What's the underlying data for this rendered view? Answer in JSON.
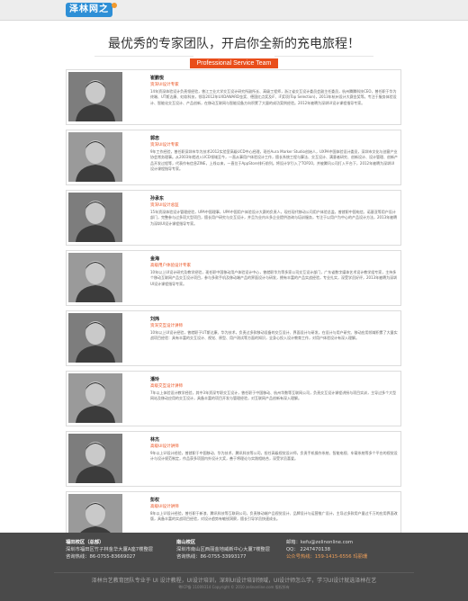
{
  "header": {
    "logo_text": "泽林网之"
  },
  "hero": {
    "title": "最优秀的专家团队，开启你全新的充电旅程！",
    "tagline": "Professional Service Team"
  },
  "experts": [
    {
      "name": "崔鹏悦",
      "role": "资深UI设计专家",
      "bio": "14年资深体验设计负责领经验，曾江工业大学交互设计研究所副所长、高级工程师，浙江省交互设计委员会副主任委员，杭州腾腾科技CEO，曾任职于华为终端、UT斯达康、虹软科技，领导2012年UXDAWARD金奖、德国红点奖及iF、iF奖项(Top Selection)，2013年杭州设计大赛金奖等。专注于服务体验设计、智能化交互设计、产品创新，在移动互联网与智能设备方向积累了大量的成功案例经验。2012年被聘为深圳UI设计课程指导专家。"
    },
    {
      "name": "郭忠",
      "role": "资深UI设计专家",
      "bio": "9年工作经验，曾任职深圳市华为技术2012实验室高级UCD中心经理，现任Aura Marker Studio创始人，UXPA中国体验设计委员，深圳市文化与创意产业协会常务理事。从2003年就进入UCD领域至今，一直从事用户体验设计工作，擅长系统工程与算法、交互设计、满意者研究、创新设计、设计管理、创新产品开发过程等，代表作有信息ZINE，上线以来，一直位于AppStore排行前列。将设计学引入了TOP20，并被腾讯公司打入平台下，2012年被聘为深圳UI设计课程指导专家。"
    },
    {
      "name": "孙承东",
      "role": "资深UI设计总监",
      "bio": "15年资深体验设计管理经验，UPA中国理事，UPA中国用户体验设计大赛的负责人，现任现代移动公司用户体验总监，曾就职中国电信、诺基亚等用户设计部门，完整参与过多项大型项目，擅长用户研究与交互设计，并且为业内众多企业提供咨询与培训服务，专注于以用户为中心的产品设计方法，2013年被聘为深圳UI设计课程指导专家。"
    },
    {
      "name": "金海",
      "role": "高级用户体验设计专家",
      "bio": "10年以上UI设计研究及教学经验，现任职中国移动用户体验设计中心，曾就职华为等多家公司交互设计部门，广东省数字媒体艺术设计教学组专家，主持多个移动互联网产品交互设计项目，参与多款手机及移动端产品的界面设计与研发，拥有丰富的产品实战经验，专业扎实，深受学员好评，2013年被聘为深圳UI设计课程指导专家。"
    },
    {
      "name": "刘炜",
      "role": "资深交互设计讲师",
      "bio": "10年以上UI设计经验，曾就职于UT斯达康、华为技术，负责过多款移动设备的交互设计、界面设计与研发，在设计与用户研究、移动应用领域积累了大量实战项目经验：具有丰富的交互设计、视觉、原型、用户测试等方面的知识，全身心投入设计教育工作，对用户体验设计有深入理解。"
    },
    {
      "name": "潘玲",
      "role": "高级交互设计讲师",
      "bio": "7年以上体验设计教学经验，其中3年资深专职交互设计，曾任职于中国移动、杭州华数等互联网公司，负责交互设计课程讲授与项目实训，主导过多个大型网站及移动应用的交互设计，具备丰富的项目开发与管理经验，对互联网产品创新有深入理解。"
    },
    {
      "name": "林杰",
      "role": "高级UI设计讲师",
      "bio": "9年以上UI设计经验，曾就职于中国移动、华为技术、腾讯科技等公司，担任高级视觉设计师，负责手机操作系统、智能电视、车载系统等多个平台的视觉设计与设计规范制定，作品获多项国内外设计大奖，善于将理论与实践相结合，深受学员喜爱。"
    },
    {
      "name": "彭权",
      "role": "高级UI设计讲师",
      "bio": "8年以上UI设计经验，曾任职于新浪、腾讯科技等互联网公司，负责移动端产品视觉设计、品牌设计与运营推广设计，主导过多款用户量过千万的应用界面改版，具备丰富的实战项目经验，对设计趋势有敏锐洞察，擅长引导学员快速成长。"
    }
  ],
  "footer": {
    "hq": {
      "title": "福田校区（总部）",
      "address": "深圳市福田区竹子林金华大厦A座7楼整层",
      "phone": "咨询热线：86-0755-83669027"
    },
    "nanshan": {
      "title": "南山校区",
      "address": "深圳市南山区西丽金地威新中心大厦7楼整层",
      "phone": "咨询热线：86-0755-33993177"
    },
    "contact": {
      "email": "邮箱：kefu@zelinonline.com",
      "qq": "QQ：  2247470138",
      "hotline": "公众号热线：159-1415-6556 玛丽珊"
    },
    "slogan": "泽林台艺教育团队专业于 UI 设计教程，UI设计培训，深圳UI设计培训领域，UI设计师怎么学，学习UI设计就选泽林在艺",
    "copyright": "粤ICP备 11009314 Copyright © 2010 zelinonline.com 版权所有"
  },
  "colors": {
    "accent": "#e94e1b",
    "footer_bg": "#4a4a4a",
    "logo_bg": "#2e8fd6"
  }
}
